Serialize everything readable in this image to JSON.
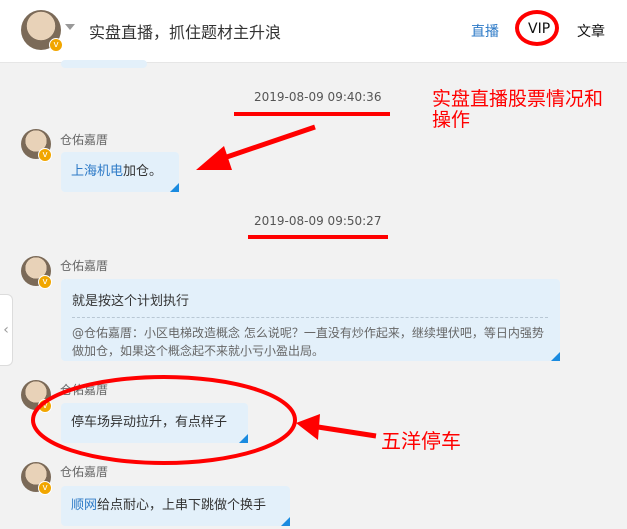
{
  "header": {
    "title": "实盘直播，抓住题材主升浪",
    "nav": {
      "live": "直播",
      "vip": "VIP",
      "article": "文章"
    },
    "badge": "v"
  },
  "timestamps": [
    "2019-08-09 09:40:36",
    "2019-08-09 09:50:27"
  ],
  "messages": [
    {
      "author": "仓佑嘉厝",
      "link_text": "上海机电",
      "text": "加仓。"
    },
    {
      "author": "仓佑嘉厝",
      "text": "就是按这个计划执行",
      "quote": "@仓佑嘉厝：小区电梯改造概念 怎么说呢？一直没有炒作起来，继续埋伏吧，等日内强势做加仓，如果这个概念起不来就小亏小盈出局。"
    },
    {
      "author": "仓佑嘉厝",
      "text": "停车场异动拉升，有点样子"
    },
    {
      "author": "仓佑嘉厝",
      "link_text": "顺网",
      "text": "给点耐心，上串下跳做个换手"
    }
  ],
  "annotations": {
    "live_stock": "实盘直播股票情况和操作",
    "wuyang": "五洋停车"
  },
  "side_tab": "‹",
  "colors": {
    "accent_link": "#2d7ac7",
    "annotation_red": "#ff0000",
    "bubble_bg": "#e3f0fa",
    "bubble_corner": "#1a8be0"
  }
}
